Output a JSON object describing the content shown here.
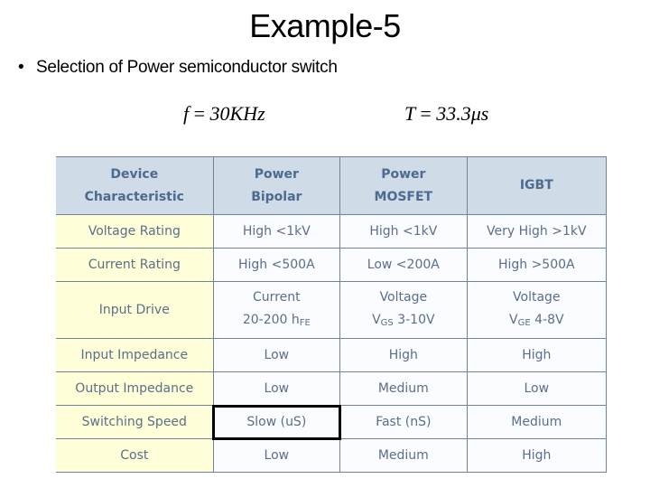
{
  "slide": {
    "title": "Example-5",
    "bullet": "Selection of Power semiconductor switch",
    "equations": {
      "frequency": {
        "lhs": "f",
        "op": "=",
        "rhs": "30KHz"
      },
      "period": {
        "lhs": "T",
        "op": "=",
        "rhs": "33.3μs"
      }
    }
  },
  "table": {
    "headers": [
      {
        "line1": "Device",
        "line2": "Characteristic"
      },
      {
        "line1": "Power",
        "line2": "Bipolar"
      },
      {
        "line1": "Power",
        "line2": "MOSFET"
      },
      {
        "line1": "IGBT",
        "line2": ""
      }
    ],
    "rows": [
      {
        "label": "Voltage Rating",
        "bipolar": "High <1kV",
        "mosfet": "High <1kV",
        "igbt": "Very High >1kV"
      },
      {
        "label": "Current Rating",
        "bipolar": "High <500A",
        "mosfet": "Low <200A",
        "igbt": "High >500A"
      },
      {
        "label": "Input Drive",
        "bipolar": {
          "line1": "Current",
          "line2": "20-200 ",
          "sub": "hFE"
        },
        "mosfet": {
          "line1": "Voltage",
          "pre": "V",
          "sub": "GS",
          "line2": " 3-10V"
        },
        "igbt": {
          "line1": "Voltage",
          "pre": "V",
          "sub": "GE",
          "line2": " 4-8V"
        }
      },
      {
        "label": "Input Impedance",
        "bipolar": "Low",
        "mosfet": "High",
        "igbt": "High"
      },
      {
        "label": "Output Impedance",
        "bipolar": "Low",
        "mosfet": "Medium",
        "igbt": "Low"
      },
      {
        "label": "Switching Speed",
        "bipolar": "Slow (uS)",
        "mosfet": "Fast (nS)",
        "igbt": "Medium"
      },
      {
        "label": "Cost",
        "bipolar": "Low",
        "mosfet": "Medium",
        "igbt": "High"
      }
    ],
    "highlighted_cell": {
      "row": "Switching Speed",
      "column": "Power Bipolar"
    }
  }
}
